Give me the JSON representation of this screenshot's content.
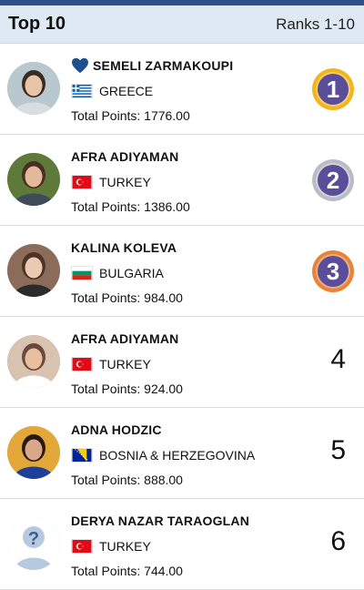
{
  "header": {
    "title": "Top 10",
    "range": "Ranks 1-10"
  },
  "entries": [
    {
      "name": "SEMELI ZARMAKOUPI",
      "favorite": true,
      "country": "GREECE",
      "flag": "greece-flag",
      "points": "Total Points: 1776.00",
      "rank": "1",
      "medal": "gold",
      "avatar": "photo"
    },
    {
      "name": "AFRA ADIYAMAN",
      "favorite": false,
      "country": "TURKEY",
      "flag": "turkey-flag",
      "points": "Total Points: 1386.00",
      "rank": "2",
      "medal": "silver",
      "avatar": "photo"
    },
    {
      "name": "KALINA KOLEVA",
      "favorite": false,
      "country": "BULGARIA",
      "flag": "bulgaria-flag",
      "points": "Total Points: 984.00",
      "rank": "3",
      "medal": "bronze",
      "avatar": "photo"
    },
    {
      "name": "AFRA ADIYAMAN",
      "favorite": false,
      "country": "TURKEY",
      "flag": "turkey-flag",
      "points": "Total Points: 924.00",
      "rank": "4",
      "medal": "",
      "avatar": "photo"
    },
    {
      "name": "ADNA HODZIC",
      "favorite": false,
      "country": "BOSNIA & HERZEGOVINA",
      "flag": "bosnia-herzegovina-flag",
      "points": "Total Points: 888.00",
      "rank": "5",
      "medal": "",
      "avatar": "photo"
    },
    {
      "name": "DERYA NAZAR TARAOGLAN",
      "favorite": false,
      "country": "TURKEY",
      "flag": "turkey-flag",
      "points": "Total Points: 744.00",
      "rank": "6",
      "medal": "",
      "avatar": "unknown-user-icon"
    }
  ],
  "colors": {
    "header_bg": "#dfe9f3",
    "top_strip": "#2f4f8a",
    "heart": "#1f4f8f",
    "gold": "#f2b51c",
    "silver": "#b8bcc6",
    "bronze": "#e8833a",
    "medal_inner": "#5a4e9a"
  }
}
